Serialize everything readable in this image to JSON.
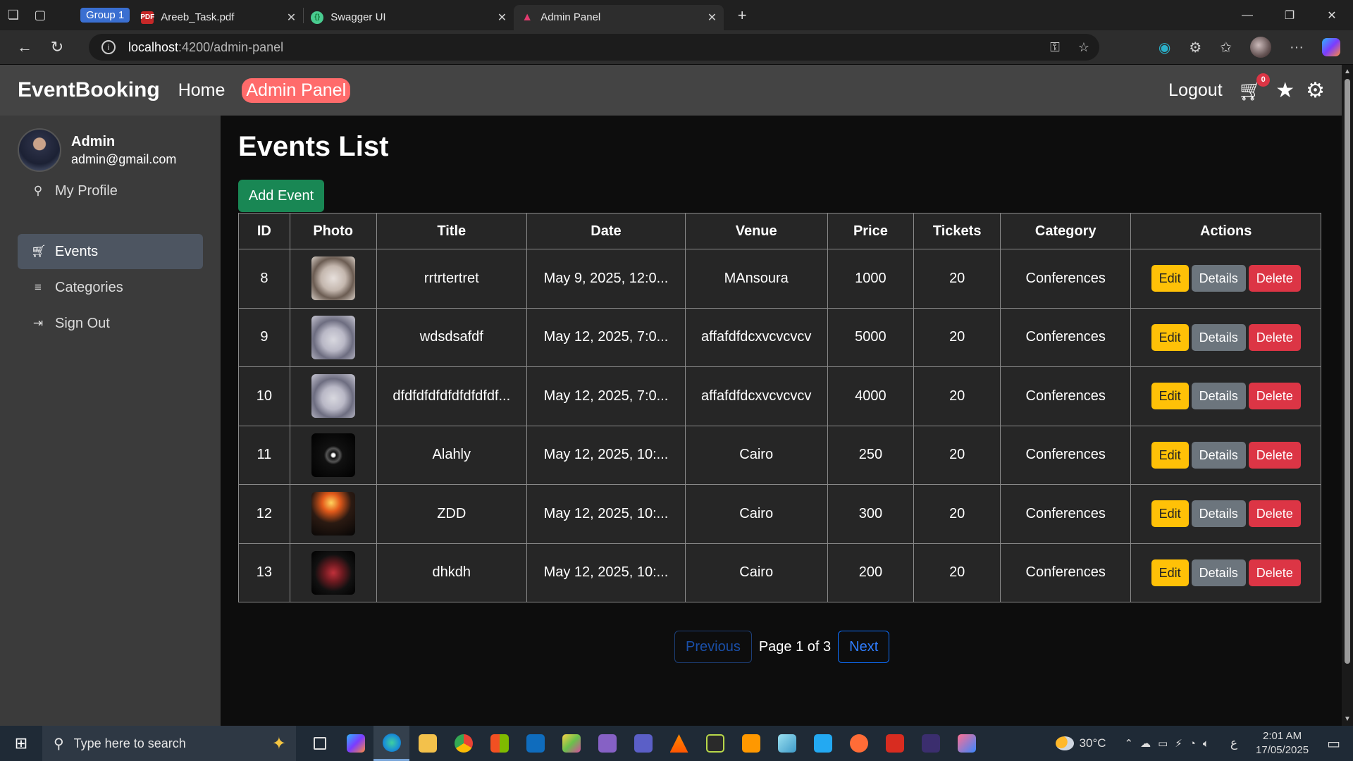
{
  "browser": {
    "tab_group": "Group 1",
    "tabs": [
      {
        "title": "Areeb_Task.pdf",
        "favicon": "pdf-icon"
      },
      {
        "title": "Swagger UI",
        "favicon": "swagger-icon"
      },
      {
        "title": "Admin Panel",
        "favicon": "angular-icon",
        "active": true
      }
    ],
    "url_host": "localhost",
    "url_path": ":4200/admin-panel"
  },
  "nav": {
    "brand": "EventBooking",
    "home": "Home",
    "admin_panel": "Admin Panel",
    "logout": "Logout",
    "cart_count": "0"
  },
  "sidebar": {
    "user_name": "Admin",
    "user_email": "admin@gmail.com",
    "items": [
      {
        "label": "My Profile",
        "icon": "user-icon"
      },
      {
        "label": "Events",
        "icon": "cart-icon",
        "active": true
      },
      {
        "label": "Categories",
        "icon": "list-icon"
      },
      {
        "label": "Sign Out",
        "icon": "sign-out-icon"
      }
    ]
  },
  "main": {
    "title": "Events List",
    "add_button": "Add Event",
    "columns": [
      "ID",
      "Photo",
      "Title",
      "Date",
      "Venue",
      "Price",
      "Tickets",
      "Category",
      "Actions"
    ],
    "rows": [
      {
        "id": "8",
        "title": "rrtrtertret",
        "date": "May 9, 2025, 12:0...",
        "venue": "MAnsoura",
        "price": "1000",
        "tickets": "20",
        "category": "Conferences"
      },
      {
        "id": "9",
        "title": "wdsdsafdf",
        "date": "May 12, 2025, 7:0...",
        "venue": "affafdfdcxvcvcvcv",
        "price": "5000",
        "tickets": "20",
        "category": "Conferences"
      },
      {
        "id": "10",
        "title": "dfdfdfdfdfdfdfdfdf...",
        "date": "May 12, 2025, 7:0...",
        "venue": "affafdfdcxvcvcvcv",
        "price": "4000",
        "tickets": "20",
        "category": "Conferences"
      },
      {
        "id": "11",
        "title": "Alahly",
        "date": "May 12, 2025, 10:...",
        "venue": "Cairo",
        "price": "250",
        "tickets": "20",
        "category": "Conferences"
      },
      {
        "id": "12",
        "title": "ZDD",
        "date": "May 12, 2025, 10:...",
        "venue": "Cairo",
        "price": "300",
        "tickets": "20",
        "category": "Conferences"
      },
      {
        "id": "13",
        "title": "dhkdh",
        "date": "May 12, 2025, 10:...",
        "venue": "Cairo",
        "price": "200",
        "tickets": "20",
        "category": "Conferences"
      }
    ],
    "actions": {
      "edit": "Edit",
      "details": "Details",
      "delete": "Delete"
    },
    "pagination": {
      "previous": "Previous",
      "info": "Page 1 of 3",
      "next": "Next"
    }
  },
  "taskbar": {
    "search_placeholder": "Type here to search",
    "temperature": "30°C",
    "time": "2:01 AM",
    "date": "17/05/2025",
    "lang": "ع"
  },
  "colors": {
    "accent_nav": "#ff6b6b",
    "add_button": "#198754",
    "edit": "#ffc107",
    "details": "#6c757d",
    "delete": "#dc3545",
    "pager": "#0d6efd"
  }
}
